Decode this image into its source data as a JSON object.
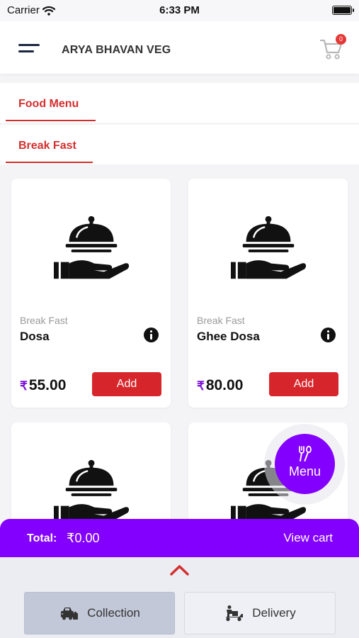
{
  "status_bar": {
    "carrier": "Carrier",
    "time": "6:33 PM"
  },
  "header": {
    "title": "ARYA BHAVAN VEG",
    "cart_count": "0"
  },
  "tabs": {
    "primary": "Food Menu",
    "secondary": "Break Fast"
  },
  "currency_symbol": "₹",
  "add_label": "Add",
  "items": [
    {
      "category": "Break Fast",
      "name": "Dosa",
      "price": "55.00"
    },
    {
      "category": "Break Fast",
      "name": "Ghee Dosa",
      "price": "80.00"
    },
    {
      "category": "",
      "name": "",
      "price": ""
    },
    {
      "category": "",
      "name": "",
      "price": ""
    }
  ],
  "fab": {
    "label": "Menu"
  },
  "cart_bar": {
    "total_label": "Total:",
    "total_value": "₹0.00",
    "view_cart": "View cart"
  },
  "modes": {
    "collection": "Collection",
    "delivery": "Delivery"
  },
  "colors": {
    "accent_red": "#d6262b",
    "accent_purple": "#8300ff"
  }
}
